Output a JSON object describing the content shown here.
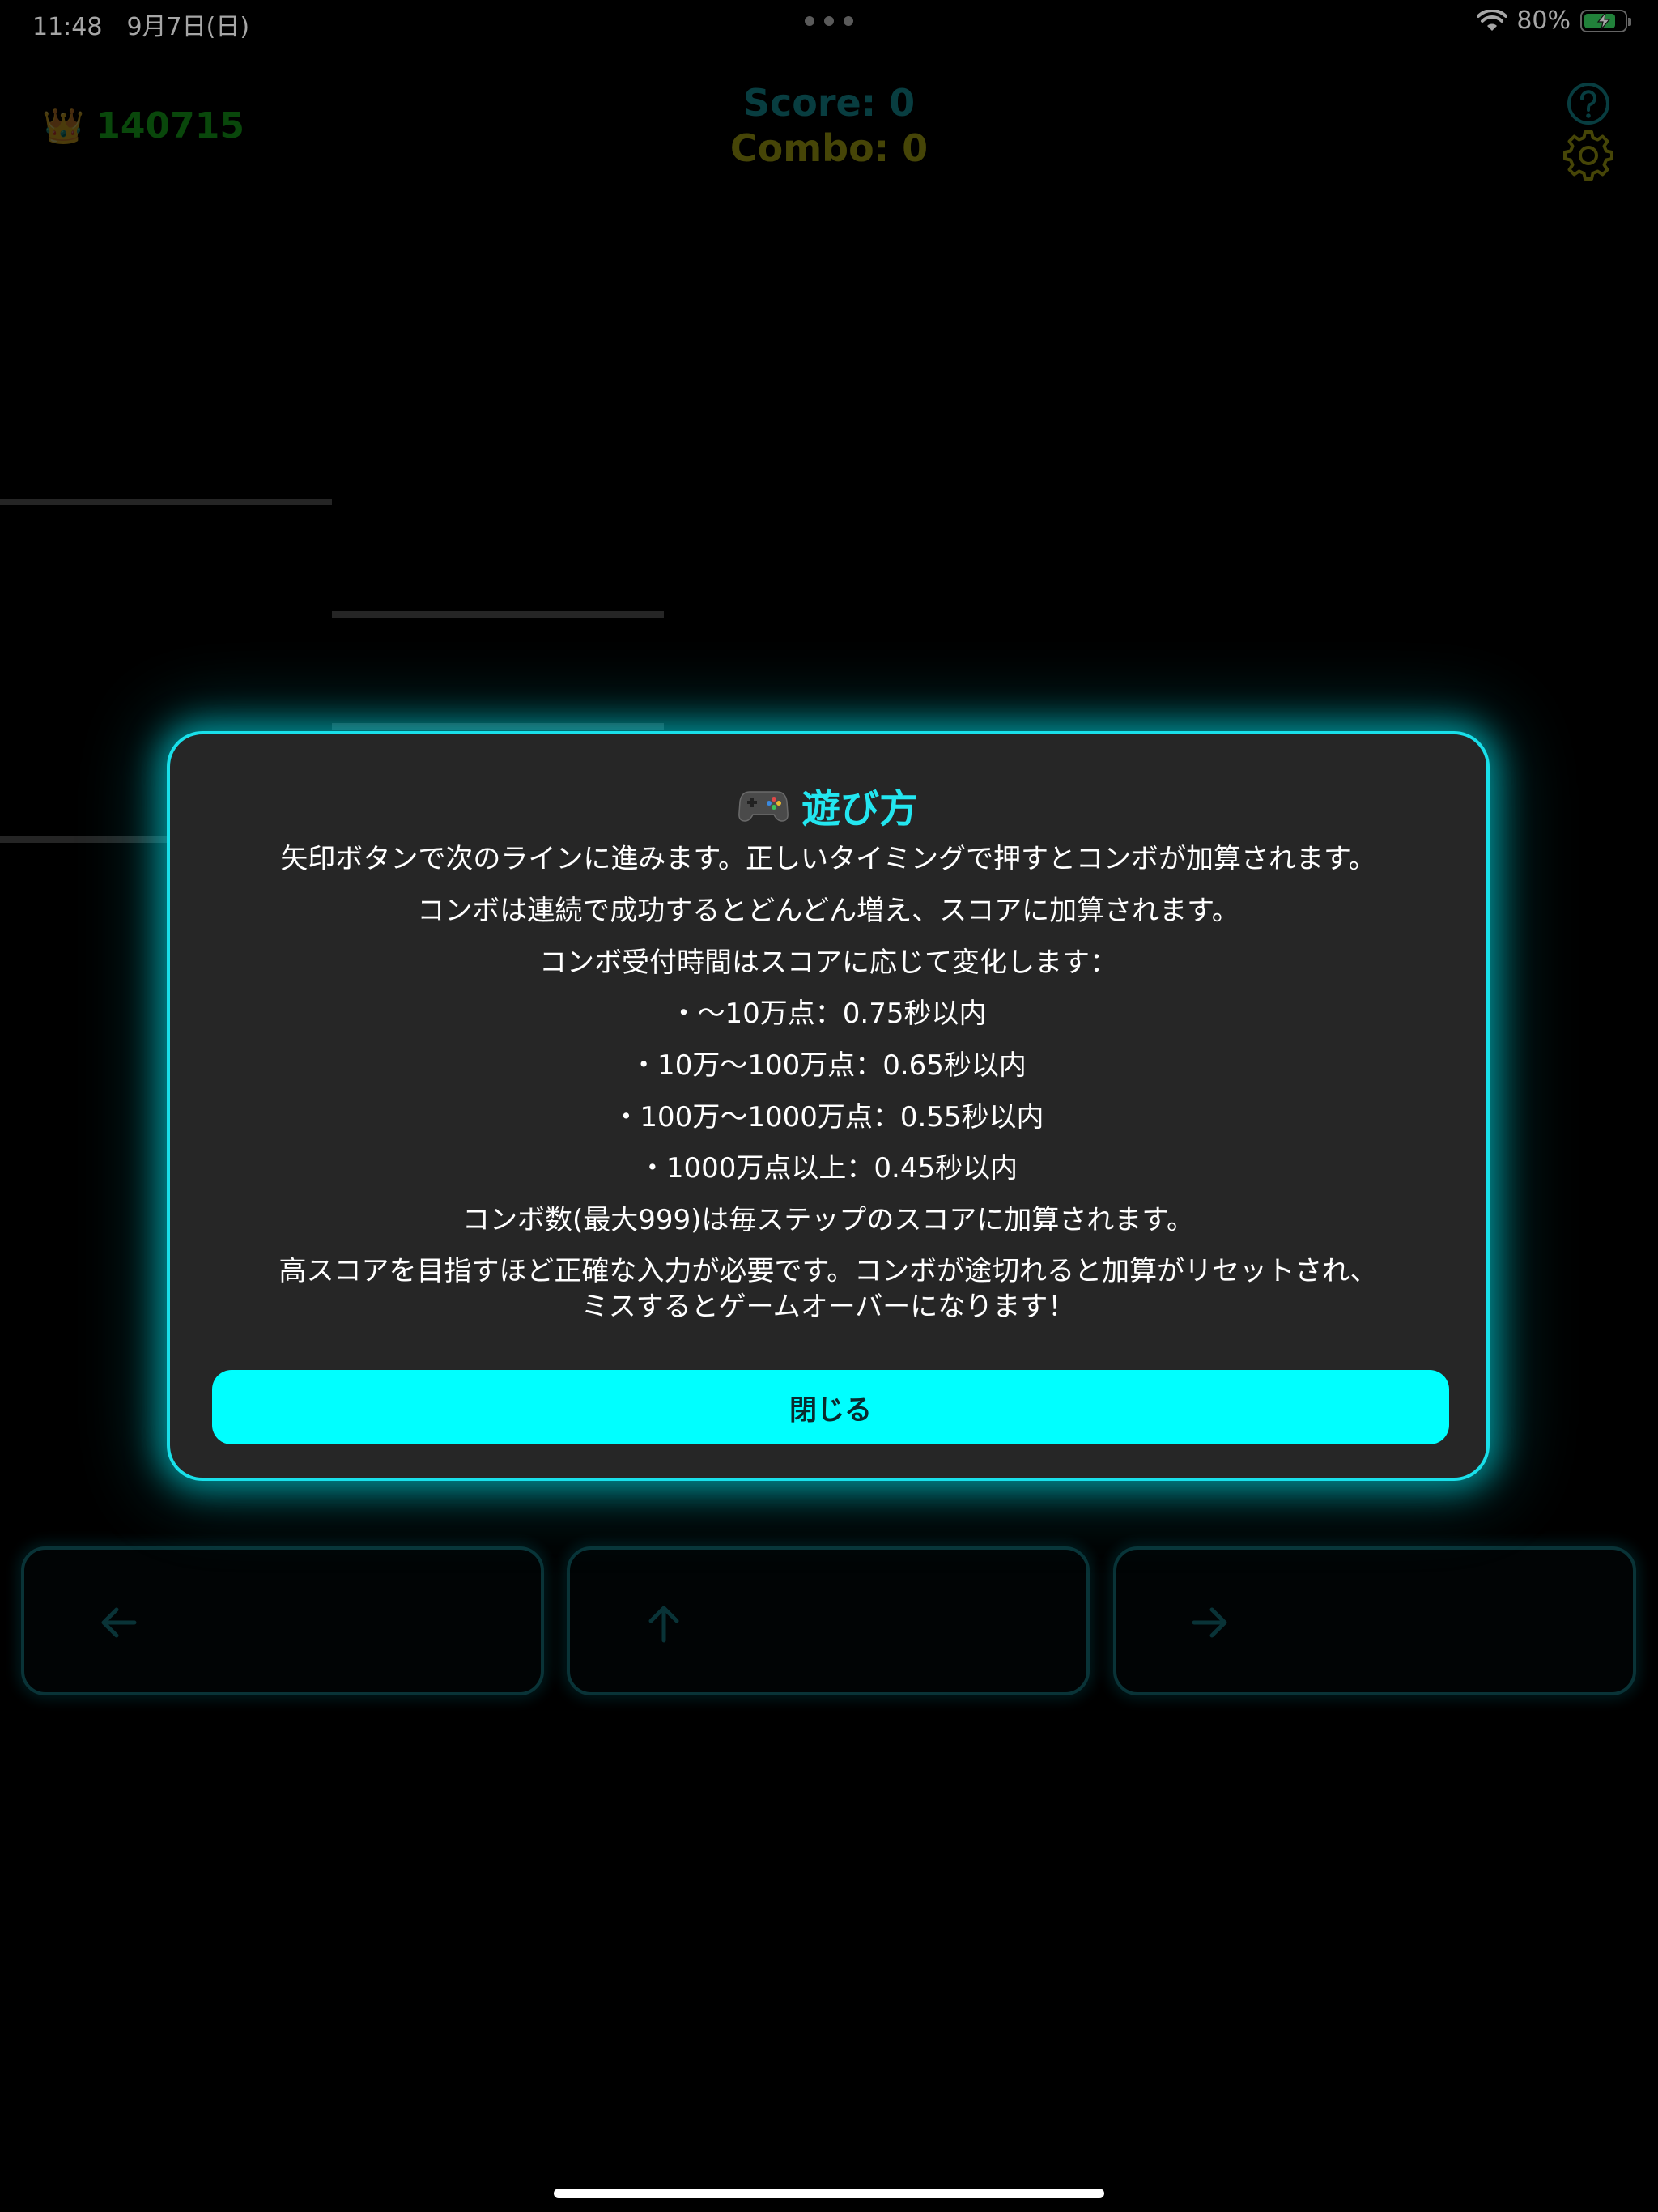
{
  "status_bar": {
    "time": "11:48　9月7日(日)",
    "battery_text": "80%",
    "battery_level": 0.8
  },
  "hud": {
    "best_score": "140715",
    "score_text": "Score: 0",
    "combo_text": "Combo: 0"
  },
  "modal": {
    "title": "遊び方",
    "lines": [
      "矢印ボタンで次のラインに進みます。正しいタイミングで押すとコンボが加算されます。",
      "コンボは連続で成功するとどんどん増え、スコアに加算されます。",
      "コンボ受付時間はスコアに応じて変化します：",
      "・〜10万点：0.75秒以内",
      "・10万〜100万点：0.65秒以内",
      "・100万〜1000万点：0.55秒以内",
      "・1000万点以上：0.45秒以内",
      "コンボ数(最大999)は毎ステップのスコアに加算されます。",
      "高スコアを目指すほど正確な入力が必要です。コンボが途切れると加算がリセットされ、",
      "ミスするとゲームオーバーになります！"
    ],
    "close_label": "閉じる"
  },
  "controls": {
    "left": "arrow-left-icon",
    "up": "arrow-up-icon",
    "right": "arrow-right-icon"
  },
  "colors": {
    "accent": "#00ffff",
    "score": "#0d5e63",
    "combo": "#6c6a0c",
    "best": "#0f6e12"
  }
}
